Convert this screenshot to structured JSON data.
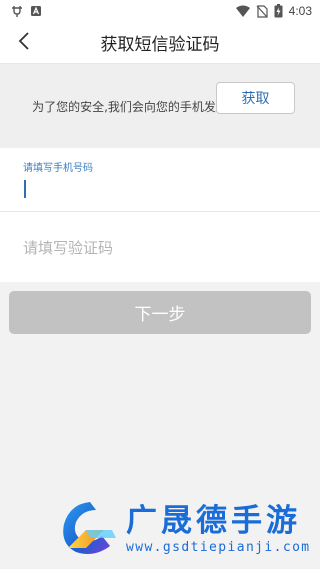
{
  "status_bar": {
    "time": "4:03",
    "left_icons": [
      "usb-charge-icon",
      "app-notification-icon"
    ],
    "right_icons": [
      "wifi-icon",
      "no-sim-icon",
      "battery-charging-icon"
    ]
  },
  "header": {
    "title": "获取短信验证码",
    "back_icon": "chevron-left-icon"
  },
  "notice": {
    "text": "为了您的安全,我们会向您的手机发送短信验证码"
  },
  "form": {
    "phone_label": "请填写手机号码",
    "phone_value": "",
    "code_placeholder": "请填写验证码",
    "code_value": "",
    "get_code_label": "获取"
  },
  "actions": {
    "next_label": "下一步"
  },
  "colors": {
    "accent": "#2d6fb4",
    "next_disabled": "#c2c2c2",
    "background": "#f2f2f2"
  },
  "watermark": {
    "brand": "广晟德手游",
    "url": "www.gsdtiepianji.com"
  }
}
